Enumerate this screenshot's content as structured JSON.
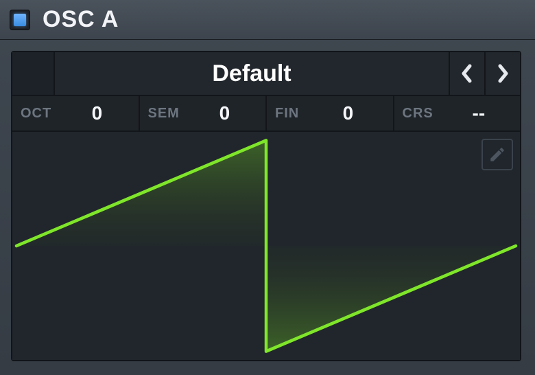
{
  "header": {
    "title": "OSC A",
    "enabled": true
  },
  "preset": {
    "name": "Default"
  },
  "params": {
    "oct": {
      "label": "OCT",
      "value": "0"
    },
    "sem": {
      "label": "SEM",
      "value": "0"
    },
    "fin": {
      "label": "FIN",
      "value": "0"
    },
    "crs": {
      "label": "CRS",
      "value": "--"
    }
  },
  "waveform": {
    "type": "sawtooth",
    "color": "#7fe62a"
  }
}
